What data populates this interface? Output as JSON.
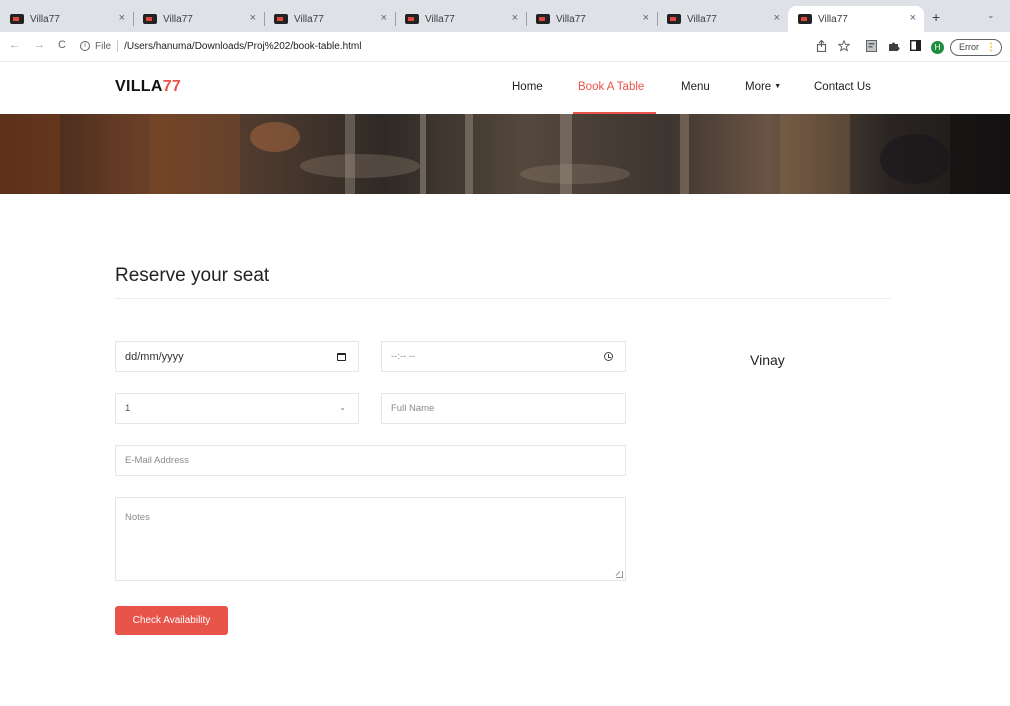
{
  "browser": {
    "tabs": [
      {
        "title": "Villa77",
        "close": "×"
      },
      {
        "title": "Villa77",
        "close": "×"
      },
      {
        "title": "Villa77",
        "close": "×"
      },
      {
        "title": "Villa77",
        "close": "×"
      },
      {
        "title": "Villa77",
        "close": "×"
      },
      {
        "title": "Villa77",
        "close": "×"
      },
      {
        "title": "Villa77",
        "close": "×",
        "active": true
      }
    ],
    "new_tab": "+",
    "tab_menu": "⌄",
    "back": "←",
    "forward": "→",
    "reload": "C",
    "info": "i",
    "scheme": "File",
    "url": "/Users/hanuma/Downloads/Proj%202/book-table.html",
    "profile_initial": "H",
    "error_label": "Error",
    "error_dots": "⋮"
  },
  "site": {
    "logo_main": "VILLA",
    "logo_accent": "77",
    "accent_color": "#e8534a",
    "nav": {
      "home": "Home",
      "book": "Book A Table",
      "menu": "Menu",
      "more": "More",
      "more_caret": "▼",
      "contact": "Contact Us"
    }
  },
  "reservation": {
    "title": "Reserve your seat",
    "date_placeholder": "dd/mm/yyyy",
    "time_placeholder": "--:-- --",
    "guests_value": "1",
    "name_placeholder": "Full Name",
    "email_placeholder": "E-Mail Address",
    "notes_placeholder": "Notes",
    "submit_label": "Check Availability"
  },
  "sidebar": {
    "name": "Vinay"
  }
}
